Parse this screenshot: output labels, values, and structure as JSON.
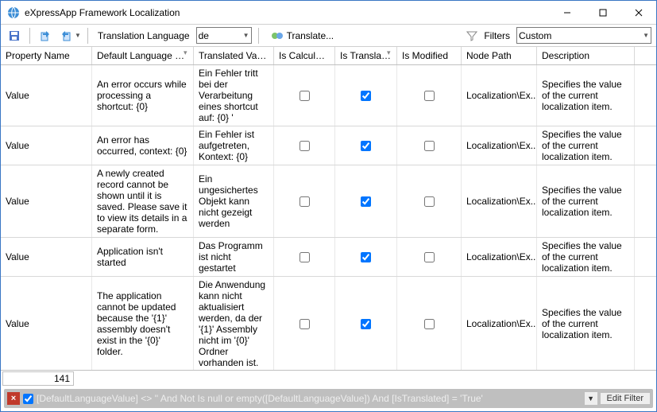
{
  "window": {
    "title": "eXpressApp Framework Localization"
  },
  "toolbar": {
    "language_label": "Translation Language",
    "language_value": "de",
    "translate_label": "Translate...",
    "filters_label": "Filters",
    "filters_value": "Custom"
  },
  "columns": {
    "prop": "Property Name",
    "def": "Default Language Value",
    "tr": "Translated Value",
    "calc": "Is Calculated",
    "istr": "Is Translated",
    "mod": "Is Modified",
    "node": "Node Path",
    "desc": "Description"
  },
  "rows": [
    {
      "prop": "Value",
      "def": "An error occurs while processing a shortcut: {0}",
      "tr": "Ein Fehler tritt bei der Verarbeitung eines shortcut auf: {0} '",
      "calc": false,
      "istr": true,
      "mod": false,
      "node": "Localization\\Ex...",
      "desc": "Specifies the value of the current localization item."
    },
    {
      "prop": "Value",
      "def": "An error has occurred, context: {0}",
      "tr": "Ein Fehler ist aufgetreten, Kontext: {0}",
      "calc": false,
      "istr": true,
      "mod": false,
      "node": "Localization\\Ex...",
      "desc": "Specifies the value of the current localization item."
    },
    {
      "prop": "Value",
      "def": "A newly created record cannot be shown until it is saved. Please save it to view its details in a separate form.",
      "tr": "Ein ungesichertes Objekt kann nicht gezeigt werden",
      "calc": false,
      "istr": true,
      "mod": false,
      "node": "Localization\\Ex...",
      "desc": "Specifies the value of the current localization item."
    },
    {
      "prop": "Value",
      "def": "Application isn't started",
      "tr": "Das Programm ist nicht gestartet",
      "calc": false,
      "istr": true,
      "mod": false,
      "node": "Localization\\Ex...",
      "desc": "Specifies the value of the current localization item."
    },
    {
      "prop": "Value",
      "def": "The application cannot be updated because the '{1}' assembly doesn't exist in the '{0}' folder.",
      "tr": "Die Anwendung kann nicht aktualisiert werden, da der '{1}' Assembly nicht im '{0}' Ordner vorhanden ist.",
      "calc": false,
      "istr": true,
      "mod": false,
      "node": "Localization\\Ex...",
      "desc": "Specifies the value of the current localization item."
    }
  ],
  "status": {
    "count": "141"
  },
  "filter": {
    "enabled": true,
    "expr": "[DefaultLanguageValue] <> '' And Not Is null or empty([DefaultLanguageValue]) And [IsTranslated] = 'True'",
    "edit_label": "Edit Filter"
  }
}
